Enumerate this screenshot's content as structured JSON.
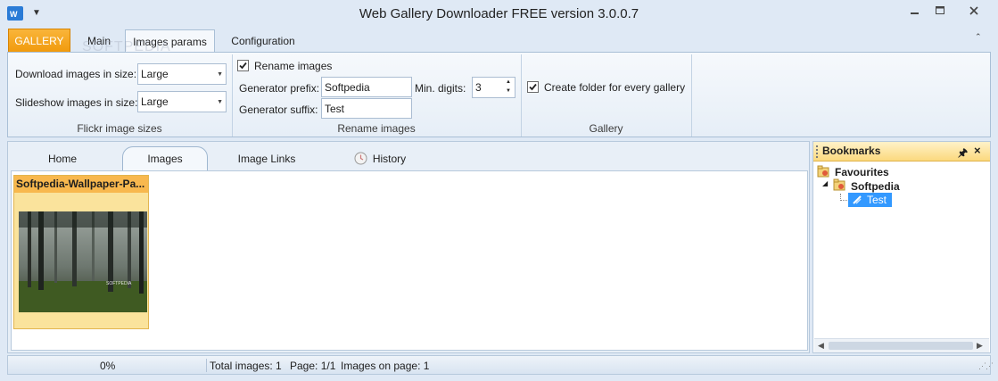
{
  "window": {
    "title": "Web Gallery Downloader FREE version 3.0.0.7",
    "min_icon": "minimize-icon",
    "max_icon": "maximize-icon",
    "close_icon": "close-icon"
  },
  "watermark": "SOFTPEDIA",
  "ribbon": {
    "tabs": {
      "gallery": "GALLERY",
      "main": "Main",
      "images_params": "Images params",
      "configuration": "Configuration"
    },
    "flickr": {
      "download_label": "Download images in size:",
      "download_value": "Large",
      "slideshow_label": "Slideshow images in size:",
      "slideshow_value": "Large",
      "group_label": "Flickr image sizes"
    },
    "rename": {
      "rename_label": "Rename images",
      "rename_checked": true,
      "prefix_label": "Generator prefix:",
      "prefix_value": "Softpedia",
      "suffix_label": "Generator suffix:",
      "suffix_value": "Test",
      "min_digits_label": "Min. digits:",
      "min_digits_value": "3",
      "group_label": "Rename images"
    },
    "gallery": {
      "create_folder_label": "Create folder for every gallery",
      "create_folder_checked": true,
      "group_label": "Gallery"
    }
  },
  "view_tabs": {
    "home": "Home",
    "images": "Images",
    "image_links": "Image Links",
    "history": "History"
  },
  "thumbnail": {
    "title": "Softpedia-Wallpaper-Pa...",
    "image_text": "SOFTPEDIA"
  },
  "bookmarks": {
    "title": "Bookmarks",
    "root": "Favourites",
    "child": "Softpedia",
    "leaf": "Test"
  },
  "status": {
    "progress": "0%",
    "total_images": "Total images: 1",
    "page": "Page: 1/1",
    "images_on_page": "Images on page: 1"
  },
  "colors": {
    "accent_orange": "#f19a0d",
    "selection_blue": "#3399ff",
    "ribbon_border": "#a9bfd6"
  }
}
